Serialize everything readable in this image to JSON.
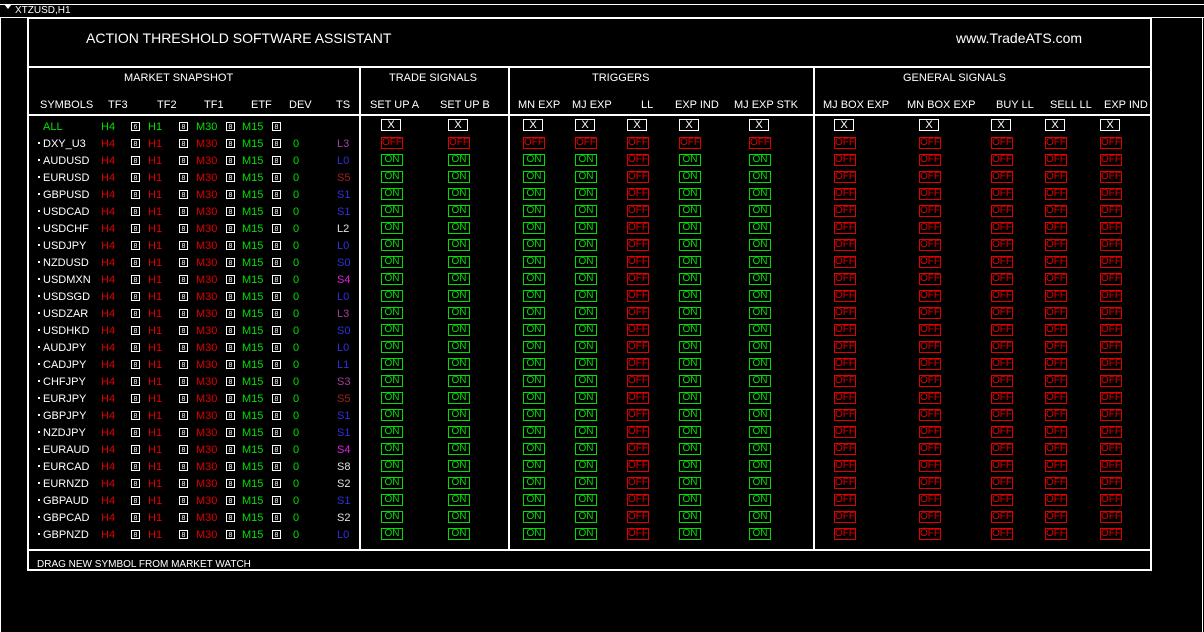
{
  "window": {
    "symbol_title": "XTZUSD,H1"
  },
  "header": {
    "title": "ACTION THRESHOLD SOFTWARE ASSISTANT",
    "site": "www.TradeATS.com"
  },
  "sections": {
    "market_snapshot": "MARKET SNAPSHOT",
    "trade_signals": "TRADE SIGNALS",
    "triggers": "TRIGGERS",
    "general_signals": "GENERAL SIGNALS"
  },
  "columns": [
    "SYMBOLS",
    "TF3",
    "TF2",
    "TF1",
    "ETF",
    "DEV",
    "TS",
    "SET UP A",
    "SET UP B",
    "MN EXP",
    "MJ EXP",
    "LL",
    "EXP IND",
    "MJ EXP STK",
    "MJ BOX EXP",
    "MN BOX EXP",
    "BUY LL",
    "SELL LL",
    "EXP IND"
  ],
  "all_row": {
    "label": "ALL",
    "tf3": "H4",
    "tf3_box": "6",
    "tf2": "H1",
    "tf2_box": "8",
    "tf1": "M30",
    "tf1_box": "8",
    "etf": "M15",
    "etf_box": "8",
    "x": "X"
  },
  "labels": {
    "tf3": "H4",
    "tf2": "H1",
    "tf1": "M30",
    "etf": "M15",
    "box": "8",
    "dev": "0",
    "on": "ON",
    "off": "OFF"
  },
  "rows": [
    {
      "symbol": "DXY_U3",
      "ts": "L3",
      "ts_color": "#a040a0",
      "state": "off"
    },
    {
      "symbol": "AUDUSD",
      "ts": "L0",
      "ts_color": "#3030e0",
      "state": "on"
    },
    {
      "symbol": "EURUSD",
      "ts": "S5",
      "ts_color": "#a02020",
      "state": "on"
    },
    {
      "symbol": "GBPUSD",
      "ts": "S1",
      "ts_color": "#3030e0",
      "state": "on"
    },
    {
      "symbol": "USDCAD",
      "ts": "S1",
      "ts_color": "#3030e0",
      "state": "on"
    },
    {
      "symbol": "USDCHF",
      "ts": "L2",
      "ts_color": "#e0e0e0",
      "state": "on"
    },
    {
      "symbol": "USDJPY",
      "ts": "L0",
      "ts_color": "#3030e0",
      "state": "on"
    },
    {
      "symbol": "NZDUSD",
      "ts": "S0",
      "ts_color": "#3030e0",
      "state": "on"
    },
    {
      "symbol": "USDMXN",
      "ts": "S4",
      "ts_color": "#e020e0",
      "state": "on"
    },
    {
      "symbol": "USDSGD",
      "ts": "L0",
      "ts_color": "#3030e0",
      "state": "on"
    },
    {
      "symbol": "USDZAR",
      "ts": "L3",
      "ts_color": "#a040a0",
      "state": "on"
    },
    {
      "symbol": "USDHKD",
      "ts": "S0",
      "ts_color": "#3030e0",
      "state": "on"
    },
    {
      "symbol": "AUDJPY",
      "ts": "L0",
      "ts_color": "#3030e0",
      "state": "on"
    },
    {
      "symbol": "CADJPY",
      "ts": "L1",
      "ts_color": "#3030e0",
      "state": "on"
    },
    {
      "symbol": "CHFJPY",
      "ts": "S3",
      "ts_color": "#a040a0",
      "state": "on"
    },
    {
      "symbol": "EURJPY",
      "ts": "S5",
      "ts_color": "#a02020",
      "state": "on"
    },
    {
      "symbol": "GBPJPY",
      "ts": "S1",
      "ts_color": "#3030e0",
      "state": "on"
    },
    {
      "symbol": "NZDJPY",
      "ts": "S1",
      "ts_color": "#3030e0",
      "state": "on"
    },
    {
      "symbol": "EURAUD",
      "ts": "S4",
      "ts_color": "#e020e0",
      "state": "on"
    },
    {
      "symbol": "EURCAD",
      "ts": "S8",
      "ts_color": "#e0e0e0",
      "state": "on"
    },
    {
      "symbol": "EURNZD",
      "ts": "S2",
      "ts_color": "#e0e0e0",
      "state": "on"
    },
    {
      "symbol": "GBPAUD",
      "ts": "S1",
      "ts_color": "#3030e0",
      "state": "on"
    },
    {
      "symbol": "GBPCAD",
      "ts": "S2",
      "ts_color": "#e0e0e0",
      "state": "on"
    },
    {
      "symbol": "GBPNZD",
      "ts": "L0",
      "ts_color": "#3030e0",
      "state": "on"
    }
  ],
  "footer": "DRAG NEW SYMBOL FROM MARKET WATCH"
}
